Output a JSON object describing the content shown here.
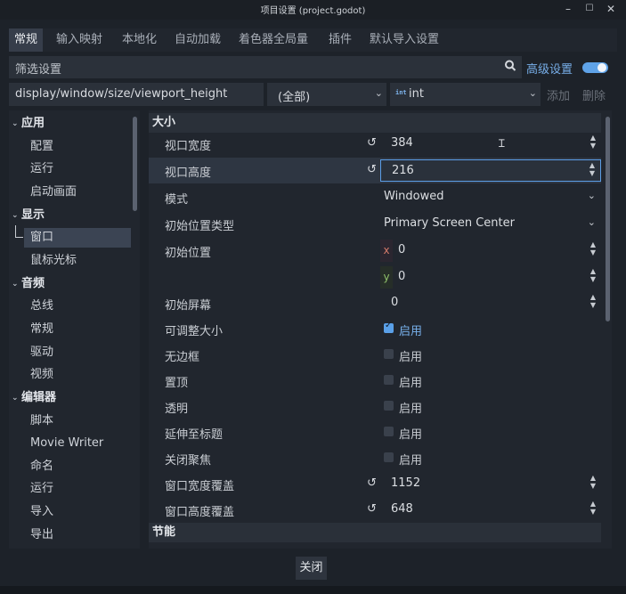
{
  "window": {
    "title": "项目设置 (project.godot)",
    "minimize": "–",
    "maximize": "☐",
    "close": "✕"
  },
  "tabs": [
    {
      "label": "常规",
      "active": true
    },
    {
      "label": "输入映射"
    },
    {
      "label": "本地化"
    },
    {
      "label": "自动加载"
    },
    {
      "label": "着色器全局量"
    },
    {
      "label": "插件"
    },
    {
      "label": "默认导入设置"
    }
  ],
  "filter": {
    "placeholder": "筛选设置",
    "advanced_label": "高级设置",
    "advanced_on": true
  },
  "property": {
    "path": "display/window/size/viewport_height",
    "scope": "(全部)",
    "type": "int",
    "type_badge": "int",
    "add": "添加",
    "delete": "删除"
  },
  "tree": [
    {
      "label": "应用",
      "category": true
    },
    {
      "label": "配置"
    },
    {
      "label": "运行"
    },
    {
      "label": "启动画面"
    },
    {
      "label": "显示",
      "category": true
    },
    {
      "label": "窗口",
      "selected": true
    },
    {
      "label": "鼠标光标"
    },
    {
      "label": "音频",
      "category": true
    },
    {
      "label": "总线"
    },
    {
      "label": "常规"
    },
    {
      "label": "驱动"
    },
    {
      "label": "视频"
    },
    {
      "label": "编辑器",
      "category": true
    },
    {
      "label": "脚本"
    },
    {
      "label": "Movie Writer"
    },
    {
      "label": "命名"
    },
    {
      "label": "运行"
    },
    {
      "label": "导入"
    },
    {
      "label": "导出"
    }
  ],
  "settings": {
    "section_size": "大小",
    "viewport_width": {
      "label": "视口宽度",
      "value": "384"
    },
    "viewport_height": {
      "label": "视口高度",
      "value": "216"
    },
    "mode": {
      "label": "模式",
      "value": "Windowed"
    },
    "initial_position_type": {
      "label": "初始位置类型",
      "value": "Primary Screen Center"
    },
    "initial_position": {
      "label": "初始位置",
      "x_axis": "x",
      "x": "0",
      "y_axis": "y",
      "y": "0"
    },
    "initial_screen": {
      "label": "初始屏幕",
      "value": "0"
    },
    "resizable": {
      "label": "可调整大小",
      "check": "启用",
      "checked": true
    },
    "borderless": {
      "label": "无边框",
      "check": "启用",
      "checked": false
    },
    "always_on_top": {
      "label": "置顶",
      "check": "启用",
      "checked": false
    },
    "transparent": {
      "label": "透明",
      "check": "启用",
      "checked": false
    },
    "extend_to_title": {
      "label": "延伸至标题",
      "check": "启用",
      "checked": false
    },
    "no_focus": {
      "label": "关闭聚焦",
      "check": "启用",
      "checked": false
    },
    "window_width_override": {
      "label": "窗口宽度覆盖",
      "value": "1152"
    },
    "window_height_override": {
      "label": "窗口高度覆盖",
      "value": "648"
    },
    "section_energy": "节能"
  },
  "footer": {
    "close": "关闭"
  },
  "colors": {
    "accent": "#5fa3e8",
    "background": "#1d2229",
    "panel": "#21262e"
  }
}
